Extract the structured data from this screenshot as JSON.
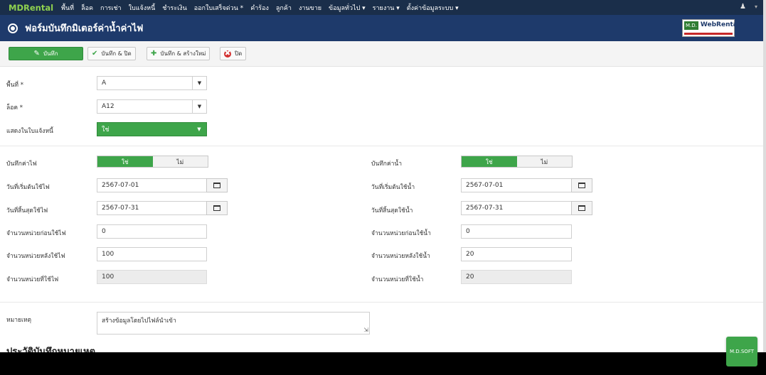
{
  "navbar": {
    "brand": "MDRental",
    "items": [
      "พื้นที่",
      "ล็อค",
      "การเช่า",
      "ใบแจ้งหนี้",
      "ชำระเงิน",
      "ออกใบเสร็จด่วน *",
      "คำร้อง",
      "ลูกค้า",
      "งานขาย",
      "ข้อมูลทั่วไป ▾",
      "รายงาน ▾",
      "ตั้งค่าข้อมูลระบบ ▾"
    ]
  },
  "title": "ฟอร์มบันทึกมิเตอร์ค่าน้ำค่าไฟ",
  "logo": {
    "md": "M.D.",
    "name": "WebRental"
  },
  "toolbar": {
    "save": "บันทึก",
    "save_close": "บันทึก & ปิด",
    "save_new": "บันทึก & สร้างใหม่",
    "close": "ปิด"
  },
  "form": {
    "area": {
      "label": "พื้นที่ *",
      "value": "A"
    },
    "lock": {
      "label": "ล็อค *",
      "value": "A12"
    },
    "show_invoice": {
      "label": "แสดงในใบแจ้งหนี้",
      "value": "ใช่"
    },
    "electric": {
      "record_label": "บันทึกค่าไฟ",
      "toggle_yes": "ใช่",
      "toggle_no": "ไม่",
      "start_label": "วันที่เริ่มต้นใช้ไฟ",
      "start_value": "2567-07-01",
      "end_label": "วันที่สิ้นสุดใช้ไฟ",
      "end_value": "2567-07-31",
      "before_label": "จำนวนหน่วยก่อนใช้ไฟ",
      "before_value": "0",
      "after_label": "จำนวนหน่วยหลังใช้ไฟ",
      "after_value": "100",
      "used_label": "จำนวนหน่วยที่ใช้ไฟ",
      "used_value": "100"
    },
    "water": {
      "record_label": "บันทึกค่าน้ำ",
      "toggle_yes": "ใช่",
      "toggle_no": "ไม่",
      "start_label": "วันที่เริ่มต้นใช้น้ำ",
      "start_value": "2567-07-01",
      "end_label": "วันที่สิ้นสุดใช้น้ำ",
      "end_value": "2567-07-31",
      "before_label": "จำนวนหน่วยก่อนใช้น้ำ",
      "before_value": "0",
      "after_label": "จำนวนหน่วยหลังใช้น้ำ",
      "after_value": "20",
      "used_label": "จำนวนหน่วยที่ใช้น้ำ",
      "used_value": "20"
    },
    "note": {
      "label": "หมายเหตุ",
      "value": "สร้างข้อมูลโดยไปไฟล์นำเข้า"
    }
  },
  "history_title": "ประวัติบันทึกหมายเหตุ",
  "fab_label": "M.D.SOFT"
}
